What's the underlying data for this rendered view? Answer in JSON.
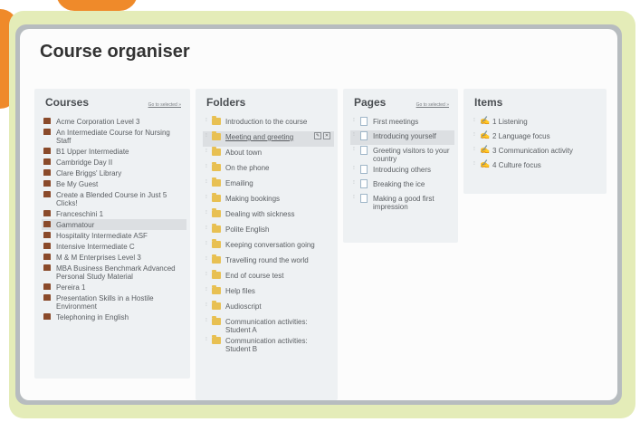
{
  "page": {
    "title": "Course organiser"
  },
  "courses": {
    "title": "Courses",
    "goto": "Go to selected »",
    "items": [
      "Acme Corporation Level 3",
      "An Intermediate Course for Nursing Staff",
      "B1 Upper Intermediate",
      "Cambridge Day II",
      "Clare Briggs' Library",
      "Be My Guest",
      "Create a Blended Course in Just 5 Clicks!",
      "Franceschini 1",
      "Gammatour",
      "Hospitality Intermediate ASF",
      "Intensive Intermediate C",
      "M & M Enterprises Level 3",
      "MBA Business Benchmark Advanced Personal Study Material",
      "Pereira 1",
      "Presentation Skills in a Hostile Environment",
      "Telephoning in English"
    ],
    "selected_index": 8
  },
  "folders": {
    "title": "Folders",
    "items": [
      "Introduction to the course",
      "Meeting and greeting",
      "About town",
      "On the phone",
      "Emailing",
      "Making bookings",
      "Dealing with sickness",
      "Polite English",
      "Keeping conversation going",
      "Travelling round the world",
      "End of course test",
      "Help files",
      "Audioscript",
      "Communication activities: Student A",
      "Communication activities: Student B"
    ],
    "selected_index": 1
  },
  "pages": {
    "title": "Pages",
    "goto": "Go to selected »",
    "items": [
      "First meetings",
      "Introducing yourself",
      "Greeting visitors to your country",
      "Introducing others",
      "Breaking the ice",
      "Making a good first impression"
    ],
    "selected_index": 1
  },
  "items": {
    "title": "Items",
    "entries": [
      "1 Listening",
      "2 Language focus",
      "3 Communication activity",
      "4 Culture focus"
    ]
  },
  "colors": {
    "accent_orange": "#ef8a2a",
    "frame_green": "#e4ecb8",
    "course_icon": "#8a4a2a",
    "folder_icon": "#e8c052"
  }
}
